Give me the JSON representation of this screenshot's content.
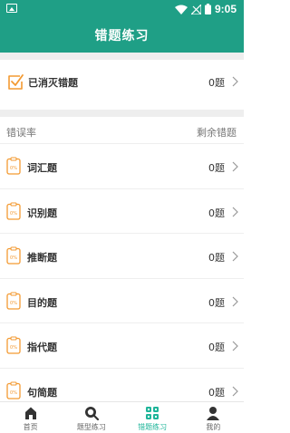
{
  "status_bar": {
    "time": "9:05"
  },
  "header": {
    "title": "错题练习"
  },
  "cleared": {
    "label": "已消灭错题",
    "count": "0题"
  },
  "list_header": {
    "left": "错误率",
    "right": "剩余错题"
  },
  "badge_text": "0%",
  "items": [
    {
      "label": "词汇题",
      "count": "0题"
    },
    {
      "label": "识别题",
      "count": "0题"
    },
    {
      "label": "推断题",
      "count": "0题"
    },
    {
      "label": "目的题",
      "count": "0题"
    },
    {
      "label": "指代题",
      "count": "0题"
    },
    {
      "label": "句简题",
      "count": "0题"
    }
  ],
  "tabs": [
    {
      "label": "首页",
      "icon": "home-icon"
    },
    {
      "label": "题型练习",
      "icon": "search-icon"
    },
    {
      "label": "错题练习",
      "icon": "grid-icon",
      "active": true
    },
    {
      "label": "我的",
      "icon": "profile-icon"
    }
  ],
  "colors": {
    "brand": "#1f9f86",
    "accent_orange": "#f39a32",
    "active_tab": "#1fb59a"
  }
}
